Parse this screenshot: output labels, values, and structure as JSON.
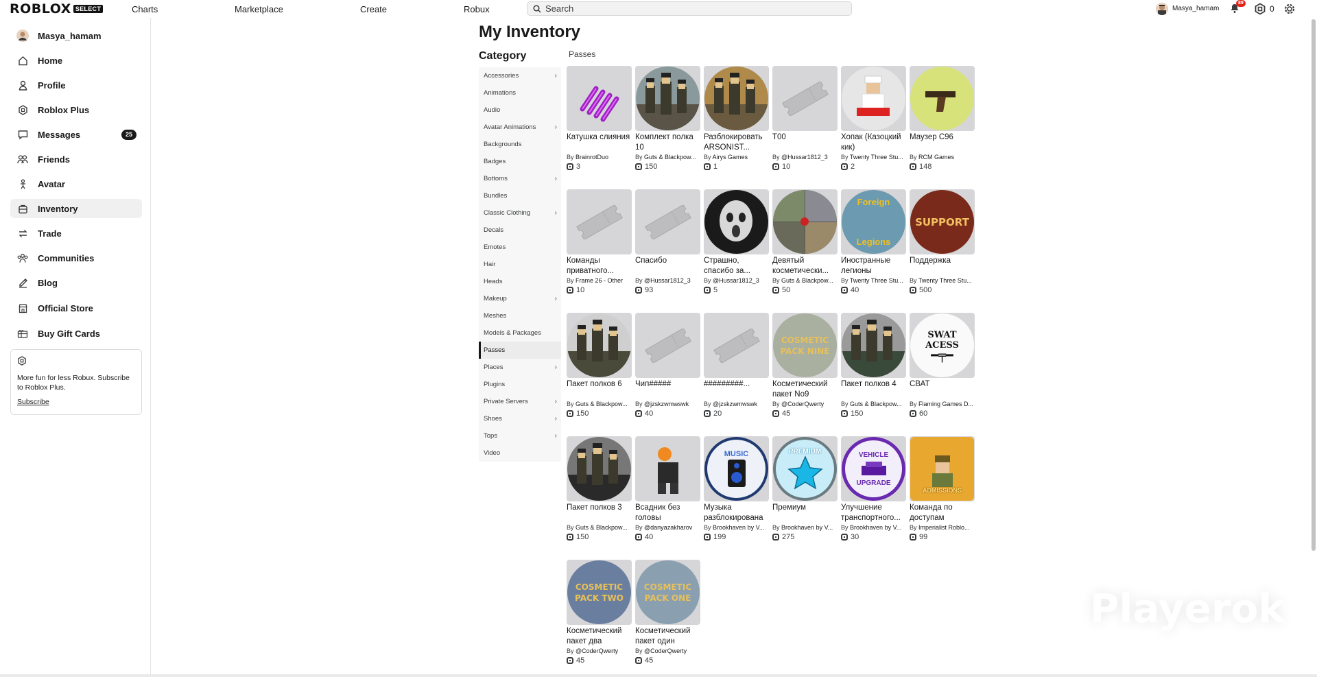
{
  "header": {
    "logo_text": "ROBLOX",
    "logo_badge": "SELECT",
    "nav": [
      "Charts",
      "Marketplace",
      "Create",
      "Robux"
    ],
    "search_placeholder": "Search",
    "username": "Masya_hamam",
    "notification_count": "89",
    "robux_balance": "0"
  },
  "sidebar": {
    "username": "Masya_hamam",
    "items": [
      {
        "label": "Home",
        "icon": "home-icon"
      },
      {
        "label": "Profile",
        "icon": "profile-icon"
      },
      {
        "label": "Roblox Plus",
        "icon": "roblox-plus-icon"
      },
      {
        "label": "Messages",
        "icon": "messages-icon",
        "badge": "25"
      },
      {
        "label": "Friends",
        "icon": "friends-icon"
      },
      {
        "label": "Avatar",
        "icon": "avatar-icon"
      },
      {
        "label": "Inventory",
        "icon": "inventory-icon",
        "active": true
      },
      {
        "label": "Trade",
        "icon": "trade-icon"
      },
      {
        "label": "Communities",
        "icon": "communities-icon"
      },
      {
        "label": "Blog",
        "icon": "blog-icon"
      },
      {
        "label": "Official Store",
        "icon": "store-icon"
      },
      {
        "label": "Buy Gift Cards",
        "icon": "gift-card-icon"
      }
    ],
    "promo": {
      "text": "More fun for less Robux. Subscribe to Roblox Plus.",
      "link": "Subscribe"
    }
  },
  "main": {
    "title": "My Inventory",
    "category_heading": "Category",
    "section_label": "Passes",
    "categories": [
      {
        "label": "Accessories",
        "chevron": true
      },
      {
        "label": "Animations"
      },
      {
        "label": "Audio"
      },
      {
        "label": "Avatar Animations",
        "chevron": true
      },
      {
        "label": "Backgrounds"
      },
      {
        "label": "Badges"
      },
      {
        "label": "Bottoms",
        "chevron": true
      },
      {
        "label": "Bundles"
      },
      {
        "label": "Classic Clothing",
        "chevron": true
      },
      {
        "label": "Decals"
      },
      {
        "label": "Emotes"
      },
      {
        "label": "Hair"
      },
      {
        "label": "Heads"
      },
      {
        "label": "Makeup",
        "chevron": true
      },
      {
        "label": "Meshes"
      },
      {
        "label": "Models & Packages"
      },
      {
        "label": "Passes",
        "active": true
      },
      {
        "label": "Places",
        "chevron": true
      },
      {
        "label": "Plugins"
      },
      {
        "label": "Private Servers",
        "chevron": true
      },
      {
        "label": "Shoes",
        "chevron": true
      },
      {
        "label": "Tops",
        "chevron": true
      },
      {
        "label": "Video"
      }
    ],
    "items": [
      {
        "name": "Катушка слияния",
        "by": "BrainrotDuo",
        "price": "3",
        "thumb": "coil"
      },
      {
        "name": "Комплект полка 10",
        "by": "Guts & Blackpow...",
        "price": "150",
        "thumb": "soldiers-a"
      },
      {
        "name": "Разблокировать ARSONIST...",
        "by": "Airys Games",
        "price": "1",
        "thumb": "soldiers-b"
      },
      {
        "name": "T00",
        "by": "@Hussar1812_3",
        "price": "10",
        "thumb": "ticket"
      },
      {
        "name": "Хопак (Казоцкий кик)",
        "by": "Twenty Three Stu...",
        "price": "2",
        "thumb": "dancer"
      },
      {
        "name": "Маузер C96",
        "by": "RCM Games",
        "price": "148",
        "thumb": "pistol"
      },
      {
        "name": "Команды приватного...",
        "by": "Frame 26 - Other",
        "price": "10",
        "thumb": "ticket"
      },
      {
        "name": "Спасибо",
        "by": "@Hussar1812_3",
        "price": "93",
        "thumb": "ticket"
      },
      {
        "name": "Страшно, спасибо за...",
        "by": "@Hussar1812_3",
        "price": "5",
        "thumb": "ghost"
      },
      {
        "name": "Девятый косметически...",
        "by": "Guts & Blackpow...",
        "price": "50",
        "thumb": "grid-soldiers"
      },
      {
        "name": "Иностранные легионы",
        "by": "Twenty Three Stu...",
        "price": "40",
        "thumb": "legions",
        "thumb_text": [
          "Foreign",
          "Legions"
        ]
      },
      {
        "name": "Поддержка",
        "by": "Twenty Three Stu...",
        "price": "500",
        "thumb": "support",
        "thumb_text": [
          "SUPPORT"
        ]
      },
      {
        "name": "Пакет полков 6",
        "by": "Guts & Blackpow...",
        "price": "150",
        "thumb": "soldiers-c"
      },
      {
        "name": "Чип#####",
        "by": "@jzskzwmwswk",
        "price": "40",
        "thumb": "ticket"
      },
      {
        "name": "#########...",
        "by": "@jzskzwmwswk",
        "price": "20",
        "thumb": "ticket"
      },
      {
        "name": "Косметический пакет No9",
        "by": "@CoderQwerty",
        "price": "45",
        "thumb": "cosmetic",
        "thumb_text": [
          "COSMETIC",
          "PACK NINE"
        ]
      },
      {
        "name": "Пакет полков 4",
        "by": "Guts & Blackpow...",
        "price": "150",
        "thumb": "soldiers-d"
      },
      {
        "name": "СВАТ",
        "by": "Flaming Games D...",
        "price": "60",
        "thumb": "swat",
        "thumb_text": [
          "SWAT",
          "ACESS"
        ]
      },
      {
        "name": "Пакет полков 3",
        "by": "Guts & Blackpow...",
        "price": "150",
        "thumb": "soldiers-e"
      },
      {
        "name": "Всадник без головы",
        "by": "@danyazakharov",
        "price": "40",
        "thumb": "headless"
      },
      {
        "name": "Музыка разблокирована",
        "by": "Brookhaven by V...",
        "price": "199",
        "thumb": "music",
        "thumb_text": [
          "MUSIC"
        ]
      },
      {
        "name": "Премиум",
        "by": "Brookhaven by V...",
        "price": "275",
        "thumb": "premium",
        "thumb_text": [
          "PREMIUM"
        ]
      },
      {
        "name": "Улучшение транспортного...",
        "by": "Brookhaven by V...",
        "price": "30",
        "thumb": "vehicle",
        "thumb_text": [
          "VEHICLE",
          "UPGRADE"
        ]
      },
      {
        "name": "Команда по доступам",
        "by": "Imperialist Roblo...",
        "price": "99",
        "thumb": "admissions",
        "thumb_text": [
          "ADMISSIONS"
        ]
      },
      {
        "name": "Косметический пакет два",
        "by": "@CoderQwerty",
        "price": "45",
        "thumb": "cosmetic2",
        "thumb_text": [
          "COSMETIC",
          "PACK TWO"
        ]
      },
      {
        "name": "Косметический пакет один",
        "by": "@CoderQwerty",
        "price": "45",
        "thumb": "cosmetic1",
        "thumb_text": [
          "COSMETIC",
          "PACK ONE"
        ]
      }
    ],
    "by_prefix": "By"
  },
  "watermark": "Playerok"
}
